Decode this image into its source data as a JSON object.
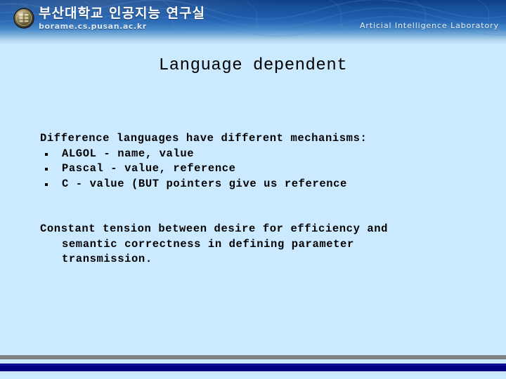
{
  "header": {
    "logo_alt": "university-seal",
    "brand_korean": "부산대학교 인공지능 연구실",
    "brand_url": "borame.cs.pusan.ac.kr",
    "lab_name": "Articial Intelligence Laboratory",
    "gradient_top_color": "#0d3f86",
    "gradient_bottom_color": "#cceaff"
  },
  "slide": {
    "title": "Language dependent",
    "background_color": "#cceaff",
    "text_color": "#000000",
    "intro": "Difference languages have different mechanisms:",
    "bullets": [
      "ALGOL - name, value",
      "Pascal - value, reference",
      "C - value (BUT pointers give us reference"
    ],
    "paragraph": {
      "line1": "Constant tension between desire for efficiency and",
      "line2": "semantic correctness in defining parameter",
      "line3": "transmission."
    }
  },
  "footer": {
    "gray_bar_color": "#808080",
    "navy_bar_color": "#000080"
  }
}
